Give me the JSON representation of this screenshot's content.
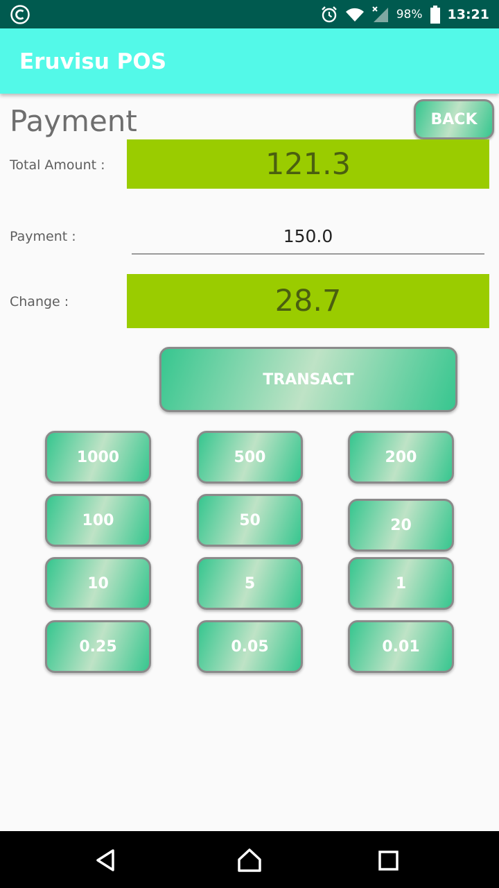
{
  "status_bar": {
    "left_icon": "c-circle-icon",
    "battery_percent": "98%",
    "time": "13:21"
  },
  "app_bar": {
    "title": "Eruvisu POS"
  },
  "page": {
    "title": "Payment",
    "back_label": "BACK",
    "total_label": "Total Amount :",
    "total_value": "121.3",
    "payment_label": "Payment :",
    "payment_value": "150.0",
    "change_label": "Change :",
    "change_value": "28.7",
    "transact_label": "TRANSACT"
  },
  "denominations": [
    "1000",
    "500",
    "200",
    "100",
    "50",
    "20",
    "10",
    "5",
    "1",
    "0.25",
    "0.05",
    "0.01"
  ],
  "colors": {
    "status_bar": "#005a4f",
    "app_bar": "#53f9e8",
    "amount_box": "#9acc00",
    "button_green": "#37c68f"
  }
}
